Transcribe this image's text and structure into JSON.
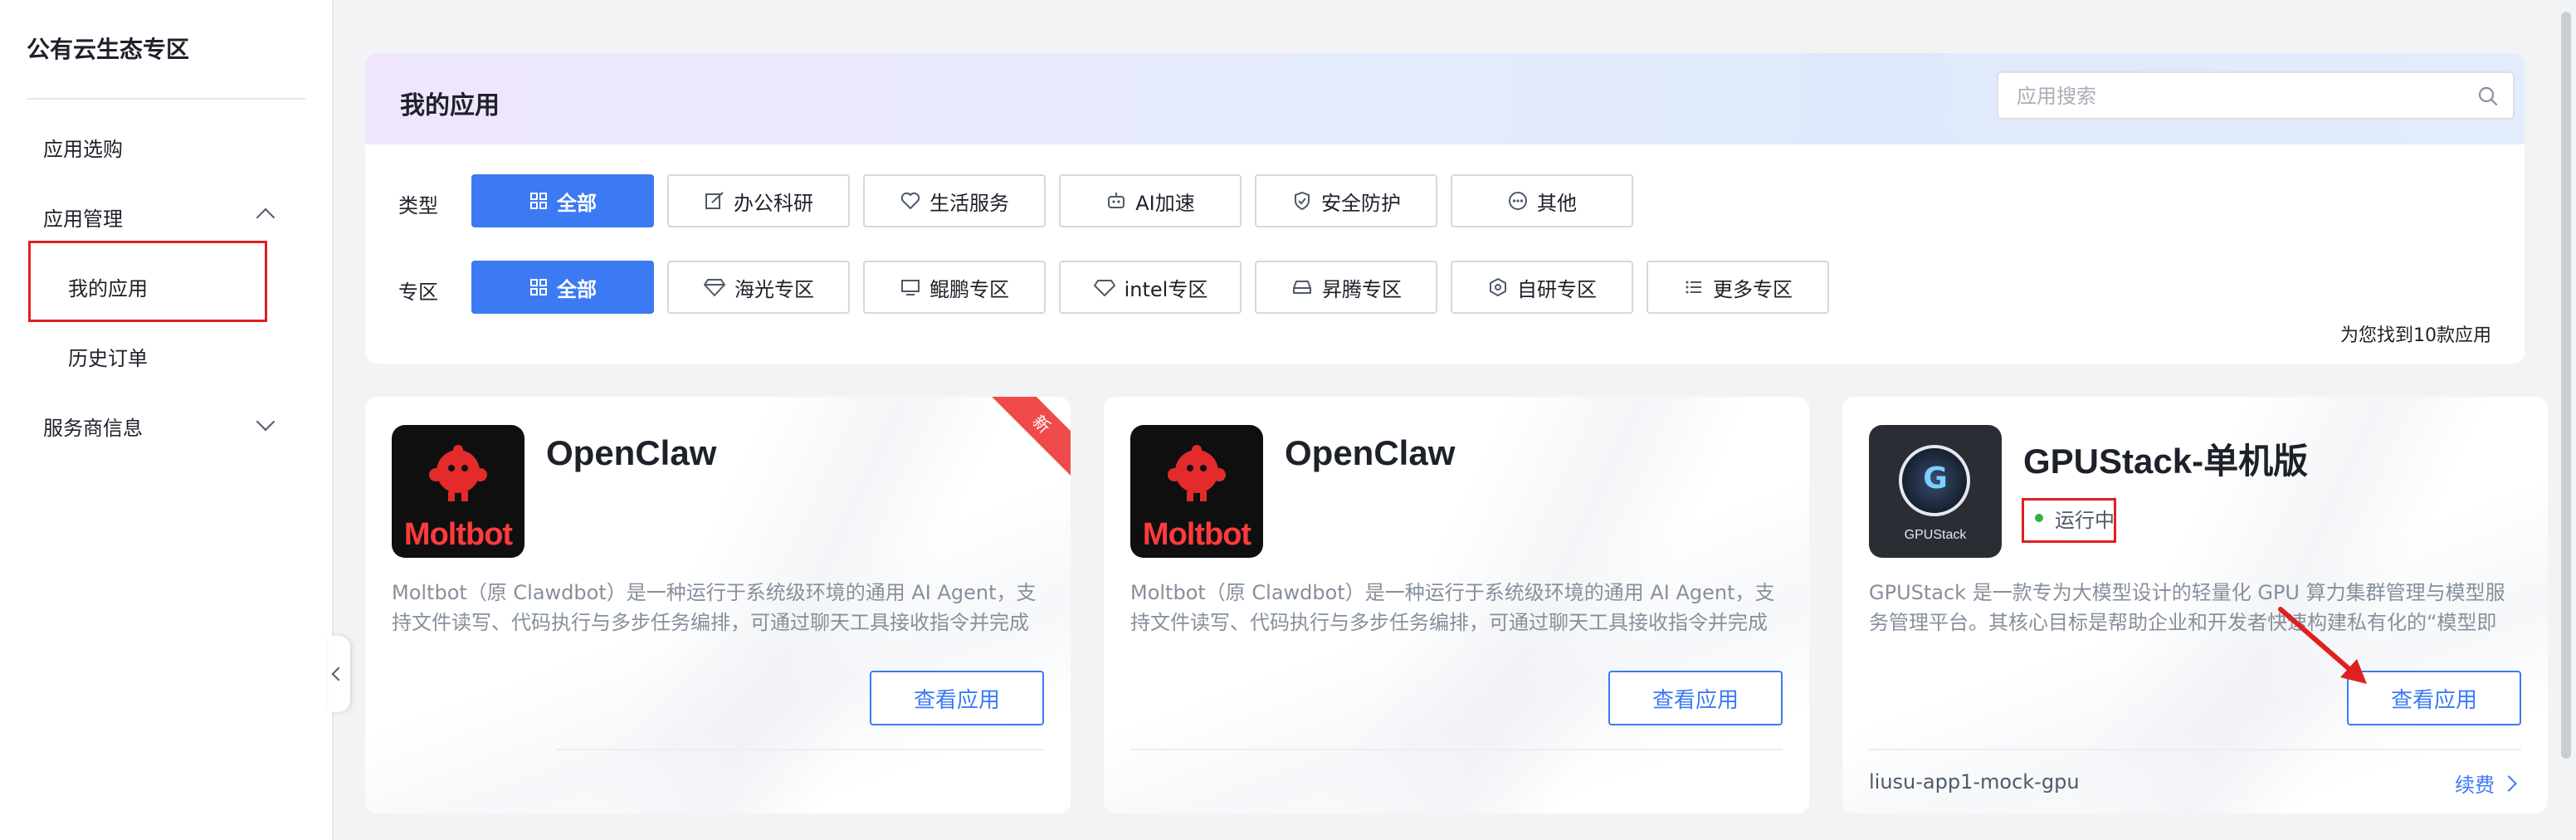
{
  "sidebar": {
    "title": "公有云生态专区",
    "items": [
      {
        "label": "应用选购"
      },
      {
        "label": "应用管理"
      },
      {
        "label": "服务商信息"
      }
    ],
    "sub_items": [
      {
        "label": "我的应用"
      },
      {
        "label": "历史订单"
      }
    ]
  },
  "panel": {
    "title": "我的应用",
    "search_placeholder": "应用搜索",
    "type_label": "类型",
    "zone_label": "专区",
    "type_chips": [
      "全部",
      "办公科研",
      "生活服务",
      "AI加速",
      "安全防护",
      "其他"
    ],
    "zone_chips": [
      "全部",
      "海光专区",
      "鲲鹏专区",
      "intel专区",
      "昇腾专区",
      "自研专区",
      "更多专区"
    ],
    "result_count": "为您找到10款应用"
  },
  "cards": [
    {
      "title": "OpenClaw",
      "logo_text": "Moltbot",
      "ribbon": "新",
      "desc": "Moltbot（原 Clawdbot）是一种运行于系统级环境的通用 AI Agent，支持文件读写、代码执行与多步任务编排，可通过聊天工具接收指令并完成操作。",
      "button": "查看应用"
    },
    {
      "title": "OpenClaw",
      "logo_text": "Moltbot",
      "desc": "Moltbot（原 Clawdbot）是一种运行于系统级环境的通用 AI Agent，支持文件读写、代码执行与多步任务编排，可通过聊天工具接收指令并完成操作。",
      "button": "查看应用"
    },
    {
      "title": "GPUStack-单机版",
      "logo_text": "GPUStack",
      "status": "运行中",
      "desc": "GPUStack 是一款专为大模型设计的轻量化 GPU 算力集群管理与模型服务管理平台。其核心目标是帮助企业和开发者快速构建私有化的“模型即服务”。",
      "button": "查看应用",
      "footer_name": "liusu-app1-mock-gpu",
      "renew": "续费"
    }
  ],
  "colors": {
    "accent": "#3b7af3",
    "highlight_box": "#e02020",
    "status_running": "#2fb344"
  }
}
